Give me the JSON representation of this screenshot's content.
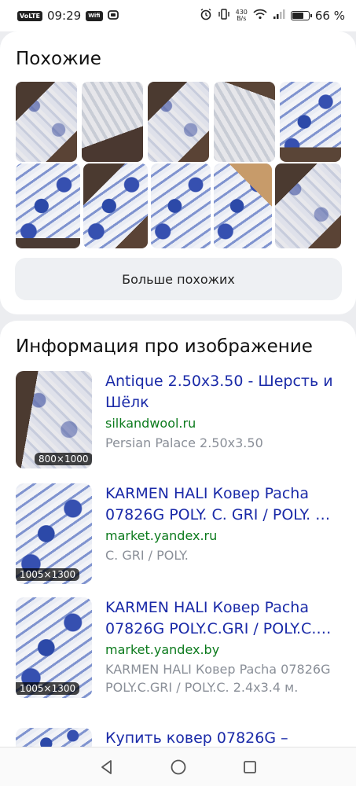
{
  "status_bar": {
    "volte": "VoLTE",
    "time": "09:29",
    "wifi_tag": "Wifi",
    "speed_value": "430",
    "speed_unit": "B/s",
    "battery": "66 %",
    "battery_level": 0.66
  },
  "similar": {
    "title": "Похожие",
    "more_button": "Больше похожих"
  },
  "info": {
    "title": "Информация про изображение",
    "results": [
      {
        "size": "800×1000",
        "title": "Antique 2.50x3.50 - Шерсть и Шёлк",
        "domain": "silkandwool.ru",
        "desc": "Persian Palace 2.50x3.50"
      },
      {
        "size": "1005×1300",
        "title": "KARMEN HALI Ковер Pacha 07826G POLY. C. GRI / POLY. …",
        "domain": "market.yandex.ru",
        "desc": "C. GRI / POLY."
      },
      {
        "size": "1005×1300",
        "title": "KARMEN HALI Ковер Pacha 07826G POLY.C.GRI / POLY.C.…",
        "domain": "market.yandex.by",
        "desc": "KARMEN HALI Ковер Pacha 07826G POLY.C.GRI / POLY.C. 2.4x3.4 м."
      },
      {
        "title": "Купить ковер 07826G –"
      }
    ]
  },
  "navbar": {
    "back": "back-icon",
    "home": "home-icon",
    "recents": "recents-icon"
  },
  "colors": {
    "link": "#1a2aa8",
    "domain": "#0b7a1c",
    "desc": "#8a8f98",
    "background": "#ecedf0"
  }
}
